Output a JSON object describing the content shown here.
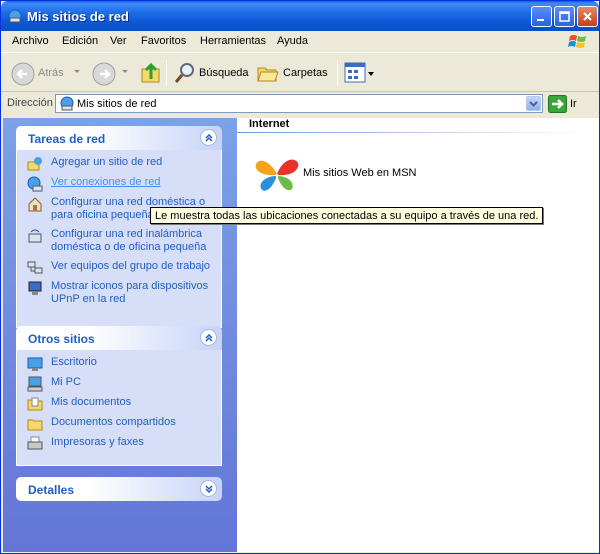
{
  "window": {
    "title": "Mis sitios de red"
  },
  "menu": {
    "items": [
      "Archivo",
      "Edición",
      "Ver",
      "Favoritos",
      "Herramientas",
      "Ayuda"
    ]
  },
  "toolbar": {
    "back_label": "Atrás",
    "search_label": "Búsqueda",
    "folders_label": "Carpetas",
    "icons": {
      "back": "back-arrow-icon",
      "forward": "forward-arrow-icon",
      "up": "folder-up-icon",
      "search": "magnifier-icon",
      "folders": "folders-icon",
      "views": "views-icon"
    }
  },
  "address": {
    "label": "Dirección",
    "value": "Mis sitios de red",
    "go_label": "Ir"
  },
  "taskpane": {
    "network_tasks": {
      "title": "Tareas de red",
      "items": [
        {
          "label": "Agregar un sitio de red",
          "icon": "add-network-place-icon"
        },
        {
          "label": "Ver conexiones de red",
          "icon": "network-connections-icon"
        },
        {
          "label": "Configurar una red doméstica o para oficina pequeña",
          "icon": "home-network-icon"
        },
        {
          "label": "Configurar una red inalámbrica doméstica o de oficina pequeña",
          "icon": "wireless-network-icon"
        },
        {
          "label": "Ver equipos del grupo de trabajo",
          "icon": "workgroup-icon"
        },
        {
          "label": "Mostrar iconos para dispositivos UPnP en la red",
          "icon": "upnp-icon"
        }
      ]
    },
    "other_places": {
      "title": "Otros sitios",
      "items": [
        {
          "label": "Escritorio",
          "icon": "desktop-icon"
        },
        {
          "label": "Mi PC",
          "icon": "my-computer-icon"
        },
        {
          "label": "Mis documentos",
          "icon": "my-documents-icon"
        },
        {
          "label": "Documentos compartidos",
          "icon": "shared-documents-icon"
        },
        {
          "label": "Impresoras y faxes",
          "icon": "printers-icon"
        }
      ]
    },
    "details": {
      "title": "Detalles"
    }
  },
  "content": {
    "group_title": "Internet",
    "items": [
      {
        "label": "Mis sitios Web en MSN",
        "icon": "msn-butterfly-icon"
      }
    ],
    "partial_text": "Web en MSN"
  },
  "tooltip": {
    "text": "Le muestra todas las ubicaciones conectadas a su equipo a través de una red."
  },
  "colors": {
    "title_bar": "#0a58d8",
    "task_link": "#215dc6",
    "task_pane_bg": "#6f8ddf",
    "tooltip_bg": "#ffffe1"
  }
}
